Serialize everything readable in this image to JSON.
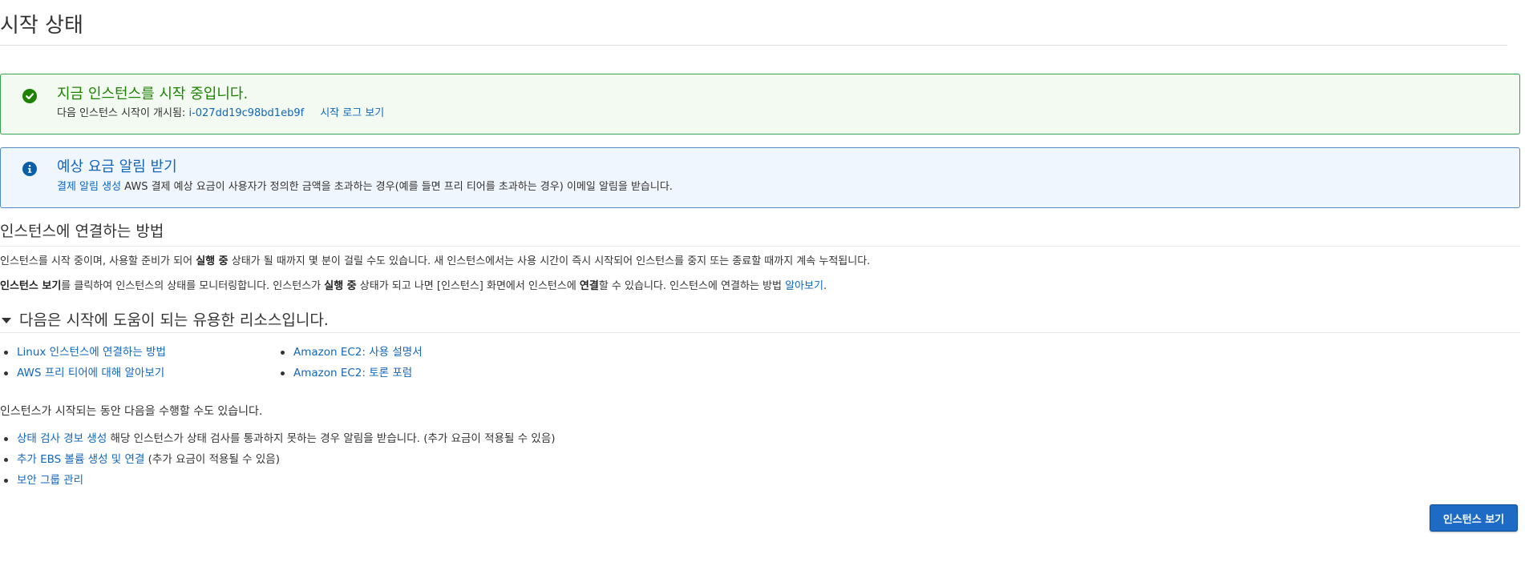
{
  "page": {
    "title": "시작 상태"
  },
  "success_alert": {
    "heading": "지금 인스턴스를 시작 중입니다.",
    "body_prefix": "다음 인스턴스 시작이 개시됨:",
    "instance_id": "i-027dd19c98bd1eb9f",
    "log_link": "시작 로그 보기",
    "color": "#1d8102"
  },
  "info_alert": {
    "heading": "예상 요금 알림 받기",
    "link": "결제 알림 생성",
    "body": "AWS 결제 예상 요금이 사용자가 정의한 금액을 초과하는 경우(예를 들면 프리 티어를 초과하는 경우) 이메일 알림을 받습니다.",
    "color": "#0b5fa8"
  },
  "connect": {
    "heading": "인스턴스에 연결하는 방법",
    "p1_a": "인스턴스를 시작 중이며, 사용할 준비가 되어 ",
    "p1_bold": "실행 중",
    "p1_b": " 상태가 될 때까지 몇 분이 걸릴 수도 있습니다. 새 인스턴스에서는 사용 시간이 즉시 시작되어 인스턴스를 중지 또는 종료할 때까지 계속 누적됩니다.",
    "p2_bold1": "인스턴스 보기",
    "p2_a": "를 클릭하여 인스턴스의 상태를 모니터링합니다. 인스턴스가 ",
    "p2_bold2": "실행 중",
    "p2_b": " 상태가 되고 나면 [인스턴스] 화면에서 인스턴스에 ",
    "p2_bold3": "연결",
    "p2_c": "할 수 있습니다. 인스턴스에 연결하는 방법 ",
    "p2_link": "알아보기",
    "p2_end": "."
  },
  "resources": {
    "heading": "다음은 시작에 도움이 되는 유용한 리소스입니다.",
    "col1": [
      "Linux 인스턴스에 연결하는 방법",
      "AWS 프리 티어에 대해 알아보기"
    ],
    "col2": [
      "Amazon EC2: 사용 설명서",
      "Amazon EC2: 토론 포럼"
    ]
  },
  "tasks": {
    "intro": "인스턴스가 시작되는 동안 다음을 수행할 수도 있습니다.",
    "items": [
      {
        "link": "상태 검사 경보 생성",
        "text": " 해당 인스턴스가 상태 검사를 통과하지 못하는 경우 알림을 받습니다. (추가 요금이 적용될 수 있음)"
      },
      {
        "link": "추가 EBS 볼륨 생성 및 연결",
        "text": " (추가 요금이 적용될 수 있음)"
      },
      {
        "link": "보안 그룹 관리",
        "text": ""
      }
    ]
  },
  "footer": {
    "view_instances_button": "인스턴스 보기",
    "button_color": "#1d6bc4"
  },
  "colors": {
    "link": "#1166bb",
    "text": "#333333"
  }
}
